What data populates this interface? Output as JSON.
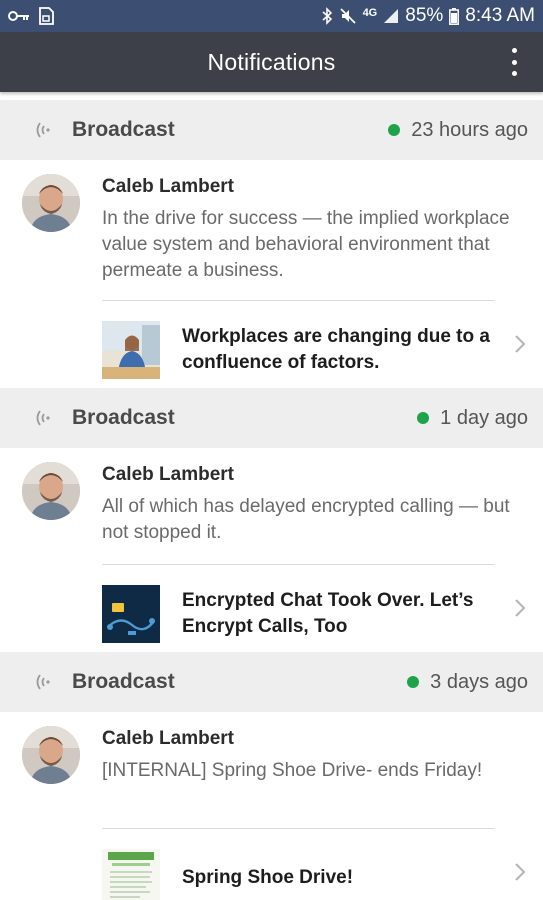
{
  "status_bar": {
    "battery": "85%",
    "time": "8:43 AM",
    "network": "4G",
    "icons": [
      "key-icon",
      "sim-icon",
      "bluetooth-icon",
      "mute-icon",
      "signal-icon",
      "battery-icon"
    ]
  },
  "app_bar": {
    "title": "Notifications",
    "menu_icon": "overflow-menu-icon"
  },
  "colors": {
    "status_bar": "#3c4f73",
    "app_bar": "#3d4048",
    "section_bg": "#eeeeee",
    "online_dot": "#1ea34a"
  },
  "notifications": [
    {
      "section_title": "Broadcast",
      "time": "23 hours ago",
      "author": "Caleb Lambert",
      "message": "In the drive for success — the implied workplace value system and behavioral environment that permeate a business.",
      "link_title": "Workplaces are changing due to a confluence of factors."
    },
    {
      "section_title": "Broadcast",
      "time": "1 day ago",
      "author": "Caleb Lambert",
      "message": "All of which has delayed encrypted calling — but not stopped it.",
      "link_title": "Encrypted Chat Took Over. Let’s Encrypt Calls, Too"
    },
    {
      "section_title": "Broadcast",
      "time": "3 days ago",
      "author": "Caleb Lambert",
      "message": "[INTERNAL] Spring Shoe Drive- ends Friday!",
      "link_title": "Spring Shoe Drive!"
    }
  ]
}
